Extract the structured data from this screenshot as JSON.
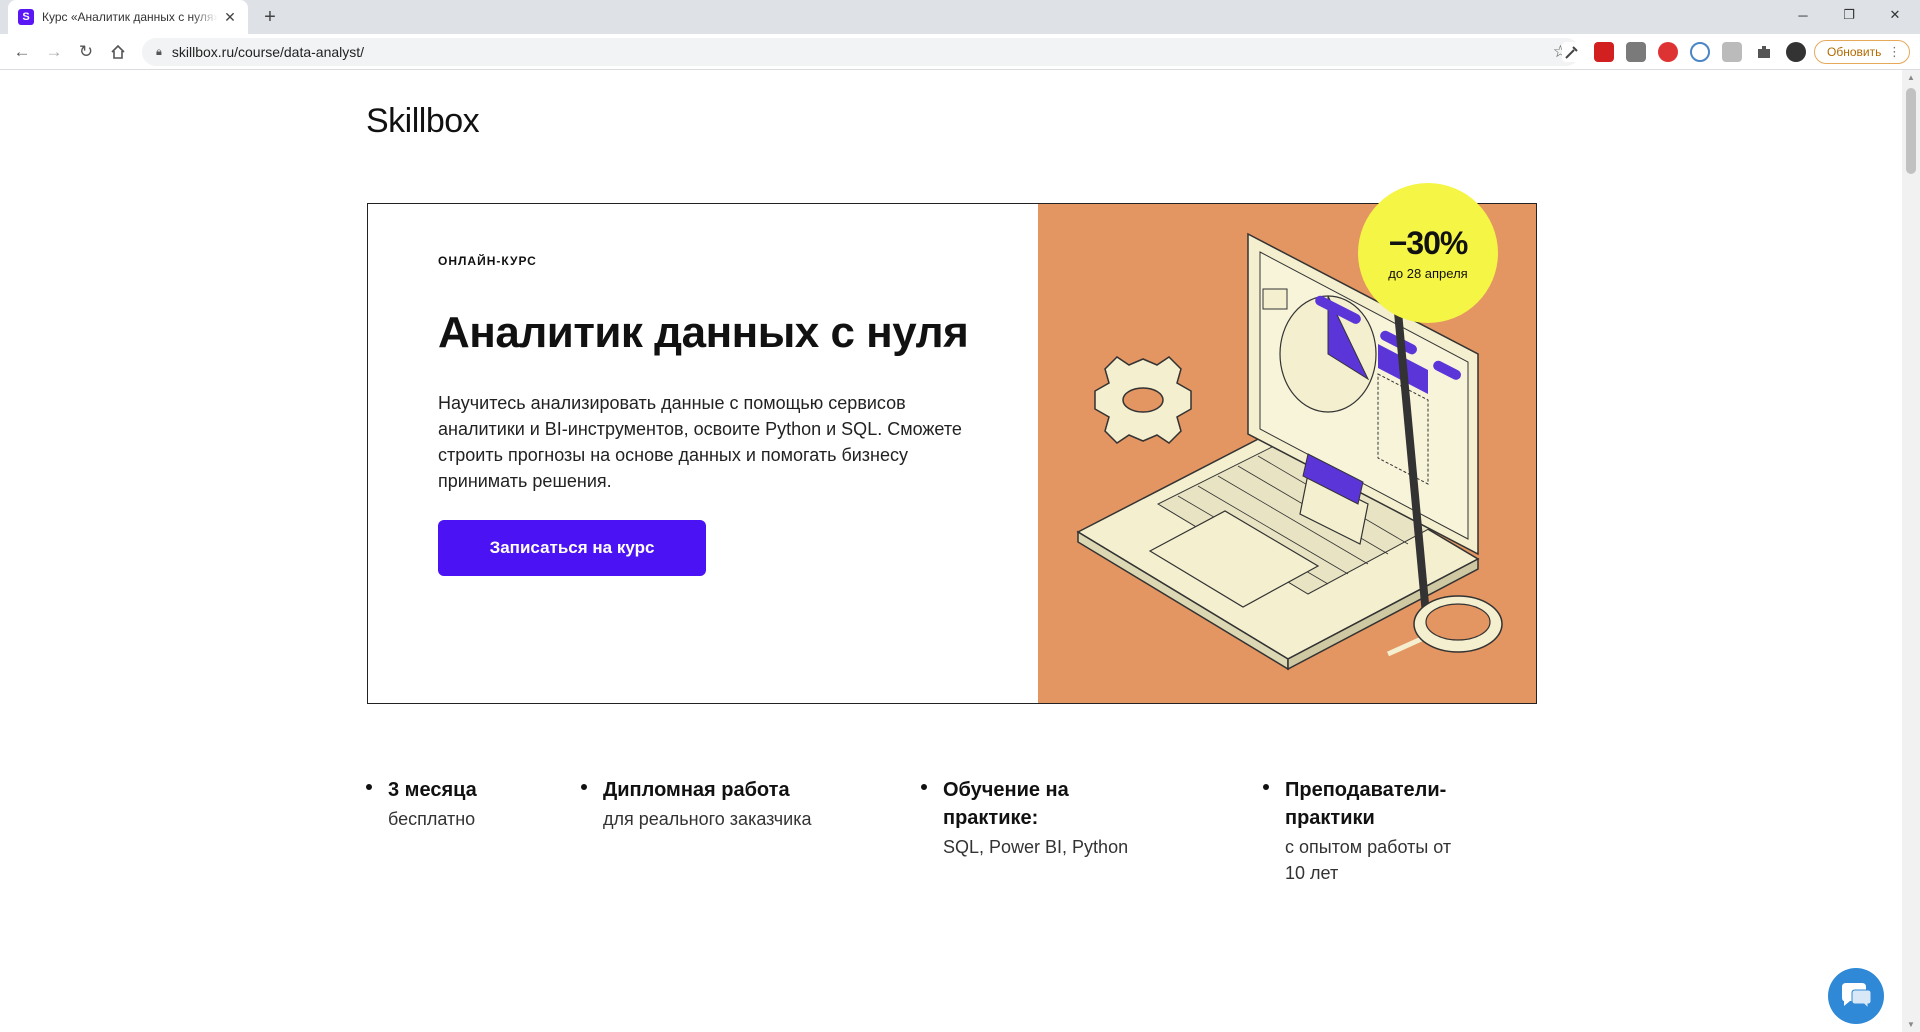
{
  "browser": {
    "tab_title": "Курс «Аналитик данных с нуля» — Skillbox",
    "favicon_letter": "S",
    "url": "skillbox.ru/course/data-analyst/",
    "update_label": "Обновить",
    "accent": "#5b16f5"
  },
  "page": {
    "logo": "Skillbox",
    "hero": {
      "kicker": "ОНЛАЙН-КУРС",
      "title": "Аналитик данных с нуля",
      "description": "Научитесь анализировать данные с помощью сервисов аналитики и BI-инструментов, освоите Python и SQL. Сможете строить прогнозы на основе данных и помогать бизнесу принимать решения.",
      "cta_label": "Записаться на курс",
      "cta_color": "#4b12f3",
      "image_bg": "#e39562"
    },
    "badge": {
      "percent": "−30%",
      "until": "до 28 апреля"
    },
    "features": [
      {
        "title": "3 месяца",
        "subtitle": "бесплатно"
      },
      {
        "title": "Дипломная работа",
        "subtitle": "для реального заказчика"
      },
      {
        "title": "Обучение на практике:",
        "subtitle": "SQL, Power BI, Python"
      },
      {
        "title": "Преподаватели-практики",
        "subtitle": "с опытом работы от 10 лет"
      }
    ]
  }
}
